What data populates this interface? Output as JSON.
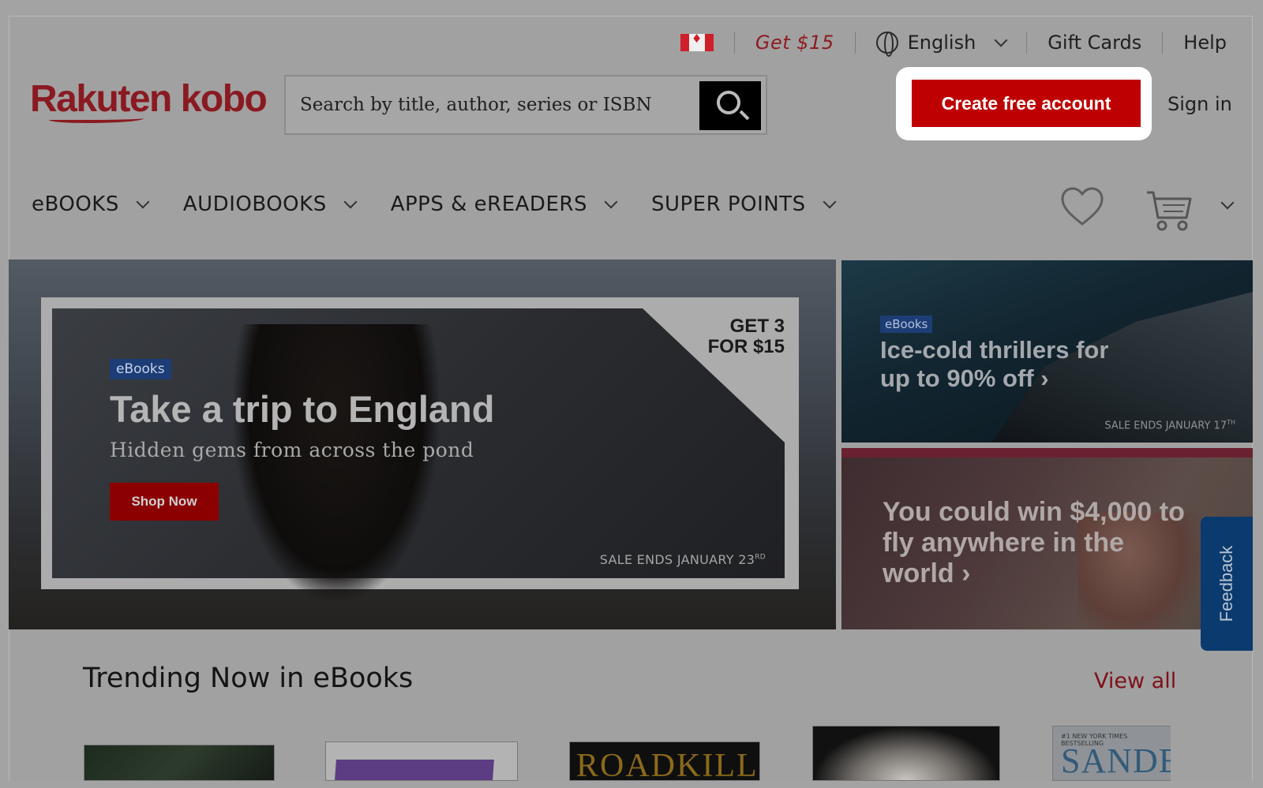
{
  "topbar": {
    "promo": "Get $15",
    "language": "English",
    "gift_cards": "Gift Cards",
    "help": "Help"
  },
  "brand": {
    "logo_text": "Rakuten kobo",
    "color": "#bf0000"
  },
  "search": {
    "placeholder": "Search by title, author, series or ISBN"
  },
  "account": {
    "create_label": "Create free account",
    "signin_label": "Sign in"
  },
  "nav": {
    "items": [
      {
        "label": "eBOOKS"
      },
      {
        "label": "AUDIOBOOKS"
      },
      {
        "label": "APPS & eREADERS"
      },
      {
        "label": "SUPER POINTS"
      }
    ]
  },
  "hero": {
    "main": {
      "tag": "eBooks",
      "title": "Take a trip to England",
      "subtitle": "Hidden gems from across the pond",
      "cta": "Shop Now",
      "offer_line1": "GET 3",
      "offer_line2": "FOR $15",
      "sale_text": "SALE ENDS JANUARY 23",
      "sale_sup": "RD"
    },
    "side1": {
      "tag": "eBooks",
      "title": "Ice-cold thrillers for up to 90% off ›",
      "sale_text": "SALE ENDS JANUARY 17",
      "sale_sup": "TH"
    },
    "side2": {
      "title": "You could win $4,000 to fly anywhere in the world ›"
    }
  },
  "feedback": {
    "label": "Feedback"
  },
  "trending": {
    "title": "Trending Now in eBooks",
    "view_all": "View all",
    "books": [
      {
        "cover_text": ""
      },
      {
        "cover_text": ""
      },
      {
        "cover_text": "ROADKILL"
      },
      {
        "cover_text": ""
      },
      {
        "cover_small": "#1 NEW YORK TIMES BESTSELLING",
        "cover_text": "SANDE"
      }
    ]
  }
}
